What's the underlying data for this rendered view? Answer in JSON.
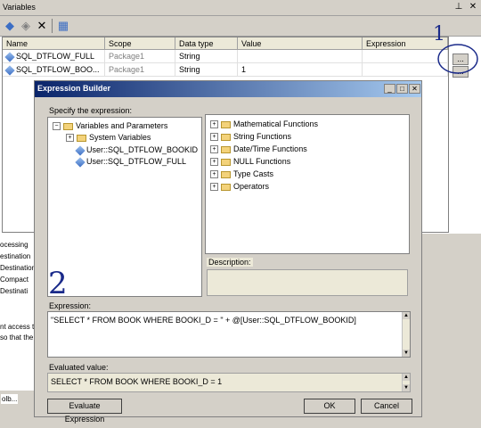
{
  "variables_window": {
    "title": "Variables",
    "close_glyph": "✕",
    "pin_glyph": "⊥",
    "toolbar": {
      "add_icon": "add-variable-icon",
      "move_icon": "move-variable-icon",
      "delete_glyph": "✕",
      "grid_icon": "grid-options-icon"
    },
    "columns": [
      "Name",
      "Scope",
      "Data type",
      "Value",
      "Expression"
    ],
    "rows": [
      {
        "name": "SQL_DTFLOW_FULL",
        "scope": "Package1",
        "type": "String",
        "value": "",
        "expression": ""
      },
      {
        "name": "SQL_DTFLOW_BOO...",
        "scope": "Package1",
        "type": "String",
        "value": "1",
        "expression": ""
      }
    ],
    "ellipsis": "..."
  },
  "background_left": {
    "items": [
      "ocessing",
      "estination",
      "Destination",
      "Compact",
      "Destinati"
    ],
    "text_lines": [
      "nt access t",
      "so that the"
    ],
    "tab_label": "olb..."
  },
  "annotations": {
    "one": "1",
    "two": "2"
  },
  "expression_builder": {
    "title": "Expression Builder",
    "specify_label": "Specify the expression:",
    "left_tree": {
      "root": "Variables and Parameters",
      "system": "System Variables",
      "vars": [
        "User::SQL_DTFLOW_BOOKID",
        "User::SQL_DTFLOW_FULL"
      ]
    },
    "right_tree": [
      "Mathematical Functions",
      "String Functions",
      "Date/Time Functions",
      "NULL Functions",
      "Type Casts",
      "Operators"
    ],
    "description_label": "Description:",
    "expression_label": "Expression:",
    "expression_text": "\"SELECT * FROM BOOK WHERE BOOKI_D = \" + @[User::SQL_DTFLOW_BOOKID]",
    "evaluated_label": "Evaluated value:",
    "evaluated_text": "SELECT * FROM BOOK WHERE BOOKI_D = 1",
    "evaluate_button": "Evaluate Expression",
    "ok_button": "OK",
    "cancel_button": "Cancel",
    "title_buttons": [
      "_",
      "□",
      "✕"
    ]
  }
}
